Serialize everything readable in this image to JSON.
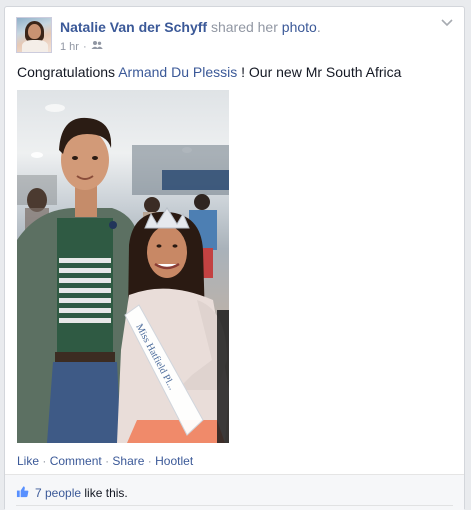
{
  "post": {
    "author": "Natalie Van der Schyff",
    "action_prefix": "shared her",
    "action_link": "photo",
    "action_suffix": ".",
    "time": "1 hr",
    "separator": "·",
    "audience_icon": "friends-icon",
    "text_before": "Congratulations",
    "mention": "Armand Du Plessis",
    "text_after": "! Our new Mr South Africa"
  },
  "photo": {
    "sash_text": "Miss Hatfield Pl..."
  },
  "actions": {
    "like": "Like",
    "comment": "Comment",
    "share": "Share",
    "hootlet": "Hootlet",
    "sep": "·"
  },
  "likes": {
    "icon": "thumbs-up-icon",
    "people": "7 people",
    "suffix": "like this."
  },
  "colors": {
    "link": "#3b5998",
    "muted": "#9197a3",
    "text": "#141823"
  }
}
